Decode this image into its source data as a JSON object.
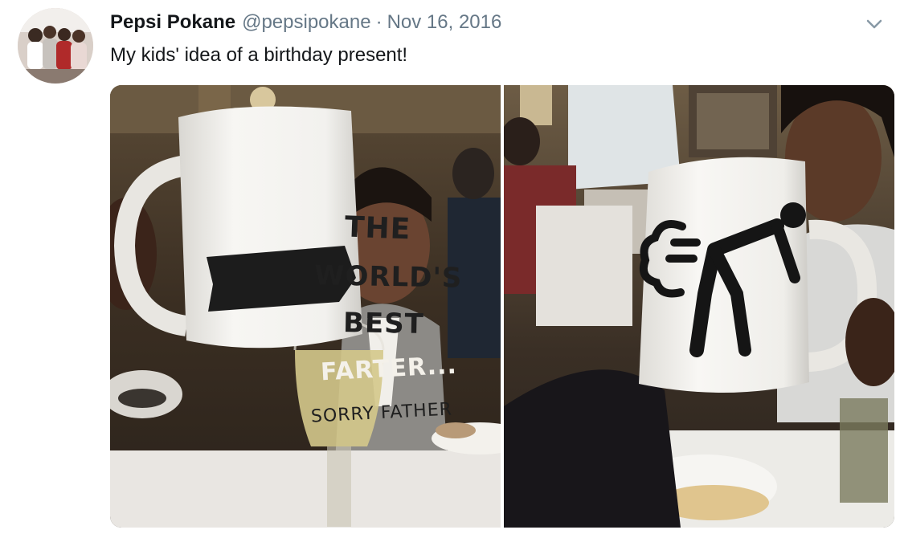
{
  "tweet": {
    "display_name": "Pepsi Pokane",
    "handle": "@pepsipokane",
    "separator": "·",
    "date": "Nov 16, 2016",
    "text": "My kids' idea of a birthday present!"
  },
  "media": {
    "photo_count": 2,
    "left_photo": {
      "mug_lines": [
        "THE",
        "WORLD'S",
        "BEST",
        "FARTER...",
        "SORRY FATHER"
      ]
    },
    "right_photo": {
      "mug_graphic": "farting-stick-figure"
    }
  },
  "icons": {
    "avatar": "avatar-photo",
    "more": "chevron-down-icon"
  },
  "colors": {
    "name": "#14171a",
    "secondary": "#657786",
    "text": "#14171a"
  }
}
